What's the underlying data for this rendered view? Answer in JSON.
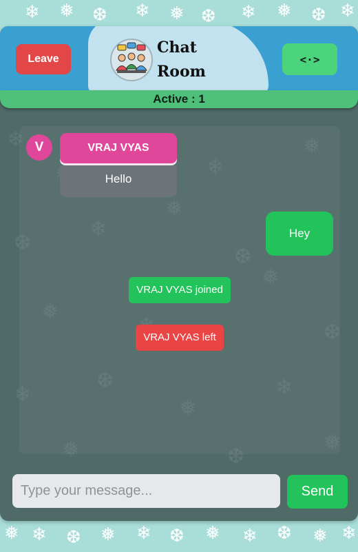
{
  "header": {
    "leave_label": "Leave",
    "share_icon": "code-arrows-icon",
    "share_glyph": "<·>",
    "title_line1": "Chat",
    "title_line2": "Room",
    "logo_icon": "group-chat-icon"
  },
  "status": {
    "active_text": "Active : 1"
  },
  "messages": {
    "incoming": {
      "avatar_letter": "V",
      "sender": "VRAJ VYAS",
      "text": "Hello"
    },
    "outgoing": {
      "text": "Hey"
    },
    "system": [
      {
        "text": "VRAJ VYAS joined",
        "kind": "join"
      },
      {
        "text": "VRAJ VYAS left",
        "kind": "leave"
      }
    ]
  },
  "composer": {
    "placeholder": "Type your message...",
    "value": "",
    "send_label": "Send"
  },
  "colors": {
    "header_bg": "#3aa0d2",
    "leave": "#e24647",
    "accent_green": "#22c35b",
    "sender_pink": "#e0469a",
    "app_bg": "#506a67",
    "page_bg": "#a9ddd8"
  }
}
